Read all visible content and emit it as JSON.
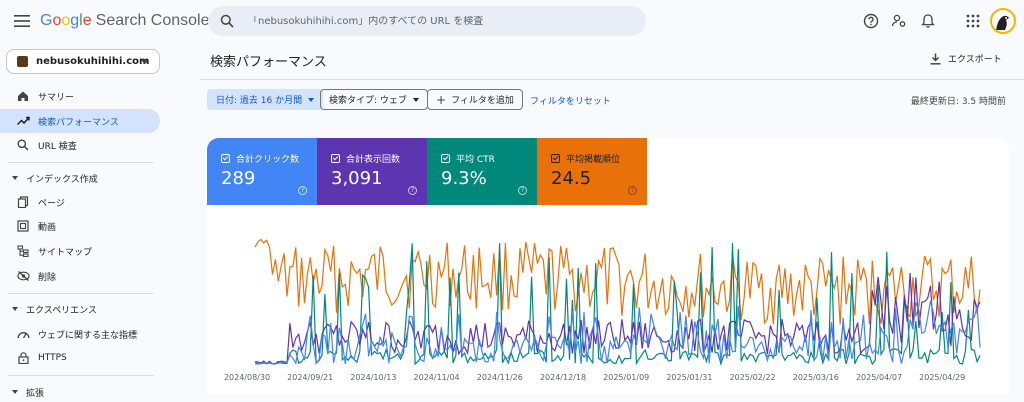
{
  "app": {
    "logo_letters": [
      "G",
      "o",
      "o",
      "g",
      "l",
      "e"
    ],
    "logo_rest": "Search Console"
  },
  "search": {
    "placeholder": "「nebusokuhihihi.com」内のすべての URL を検査"
  },
  "icons": {
    "menu": "menu-icon",
    "search": "search-icon",
    "help": "help-icon",
    "users": "manage-users-icon",
    "bell": "notifications-icon",
    "apps": "apps-grid-icon"
  },
  "property": {
    "name": "nebusokuhihihi.com"
  },
  "sidebar": {
    "items_top": [
      {
        "label": "サマリー",
        "icon": "home-icon"
      },
      {
        "label": "検索パフォーマンス",
        "icon": "trending-up-icon",
        "active": true
      },
      {
        "label": "URL 検査",
        "icon": "search-icon"
      }
    ],
    "index_section": "インデックス作成",
    "index_items": [
      {
        "label": "ページ",
        "icon": "pages-icon"
      },
      {
        "label": "動画",
        "icon": "video-icon"
      },
      {
        "label": "サイトマップ",
        "icon": "sitemap-icon"
      },
      {
        "label": "削除",
        "icon": "removals-icon"
      }
    ],
    "experience_section": "エクスペリエンス",
    "experience_items": [
      {
        "label": "ウェブに関する主な指標",
        "icon": "speed-icon"
      },
      {
        "label": "HTTPS",
        "icon": "lock-icon"
      }
    ],
    "extension_section": "拡張"
  },
  "main": {
    "title": "検索パフォーマンス",
    "export_label": "エクスポート",
    "filters": {
      "date": "日付: 過去 16 か月間",
      "search_type": "検索タイプ: ウェブ",
      "add_filter": "フィルタを追加",
      "reset": "フィルタをリセット"
    },
    "updated": "最終更新日: 3.5 時間前"
  },
  "metrics": [
    {
      "label": "合計クリック数",
      "value": "289",
      "color": "#4285f4"
    },
    {
      "label": "合計表示回数",
      "value": "3,091",
      "color": "#5e35b1"
    },
    {
      "label": "平均 CTR",
      "value": "9.3%",
      "color": "#00897b"
    },
    {
      "label": "平均掲載順位",
      "value": "24.5",
      "color": "#e8710a"
    }
  ],
  "chart_data": {
    "type": "line",
    "x_tick_labels": [
      "2024/08/30",
      "2024/09/21",
      "2024/10/13",
      "2024/11/04",
      "2024/11/26",
      "2024/12/18",
      "2025/01/09",
      "2025/01/31",
      "2025/02/22",
      "2025/03/16",
      "2025/04/07",
      "2025/04/29"
    ],
    "n_points": 250,
    "series": [
      {
        "color": "#e8710a"
      },
      {
        "color": "#00897b"
      },
      {
        "color": "#5e35b1"
      },
      {
        "color": "#4285f4"
      }
    ]
  }
}
